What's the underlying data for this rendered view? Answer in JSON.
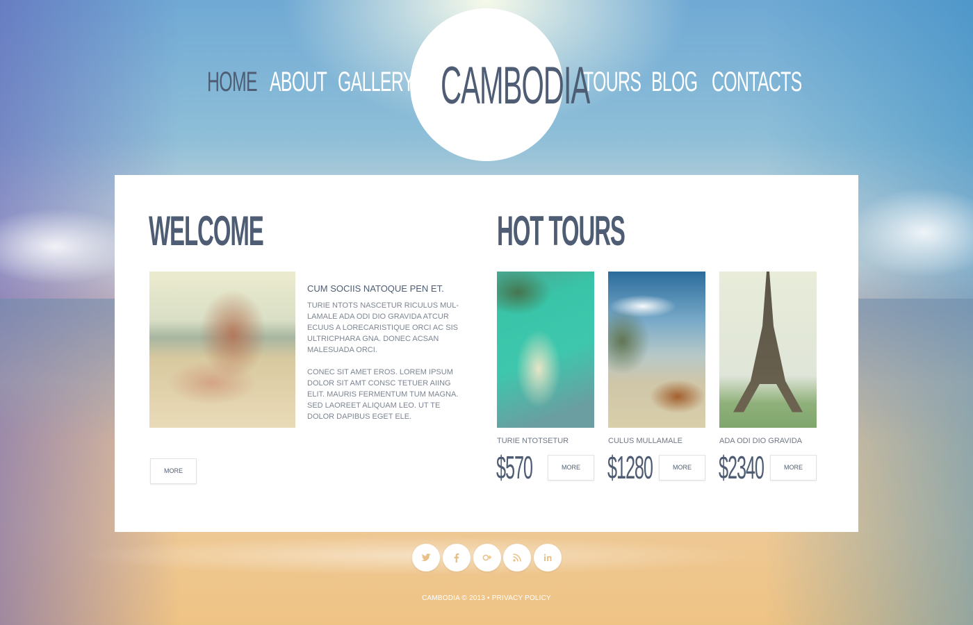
{
  "nav": {
    "left": [
      "HOME",
      "ABOUT",
      "GALLERY"
    ],
    "right": [
      "TOURS",
      "BLOG",
      "CONTACTS"
    ],
    "logo": "CAMBODIA",
    "active": "HOME"
  },
  "welcome": {
    "heading": "WELCOME",
    "subheading": "CUM SOCIIS NATOQUE PEN ET.",
    "paragraph1": "TURIE NTOTS NASCETUR RICULUS MUL- LAMALE ADA ODI DIO GRAVIDA ATCUR ECUUS A LORECARISTIQUE ORCI AC SIS ULTRICPHARA GNA. DONEC ACSAN MALESUADA ORCI.",
    "paragraph2": "CONEC SIT AMET EROS. LOREM IPSUM DOLOR SIT AMT CONSC TETUER AIING ELIT. MAURIS FERMENTUM TUM MAGNA. SED LAOREET ALIQUAM LEO. UT TE DOLOR DAPIBUS EGET ELE.",
    "more": "MORE"
  },
  "hot_tours": {
    "heading": "HOT TOURS",
    "tours": [
      {
        "name": "TURIE NTOTSETUR",
        "price": "$570",
        "more": "MORE"
      },
      {
        "name": "CULUS MULLAMALE",
        "price": "$1280",
        "more": "MORE"
      },
      {
        "name": "ADA ODI DIO GRAVIDA",
        "price": "$2340",
        "more": "MORE"
      }
    ]
  },
  "social": [
    "twitter-icon",
    "facebook-icon",
    "google-plus-icon",
    "rss-icon",
    "linkedin-icon"
  ],
  "footer": {
    "copyright": "CAMBODIA © 2013 •",
    "privacy": "PRIVACY POLICY"
  },
  "colors": {
    "accent": "#4e5d73",
    "social_icon": "#e8c088"
  }
}
